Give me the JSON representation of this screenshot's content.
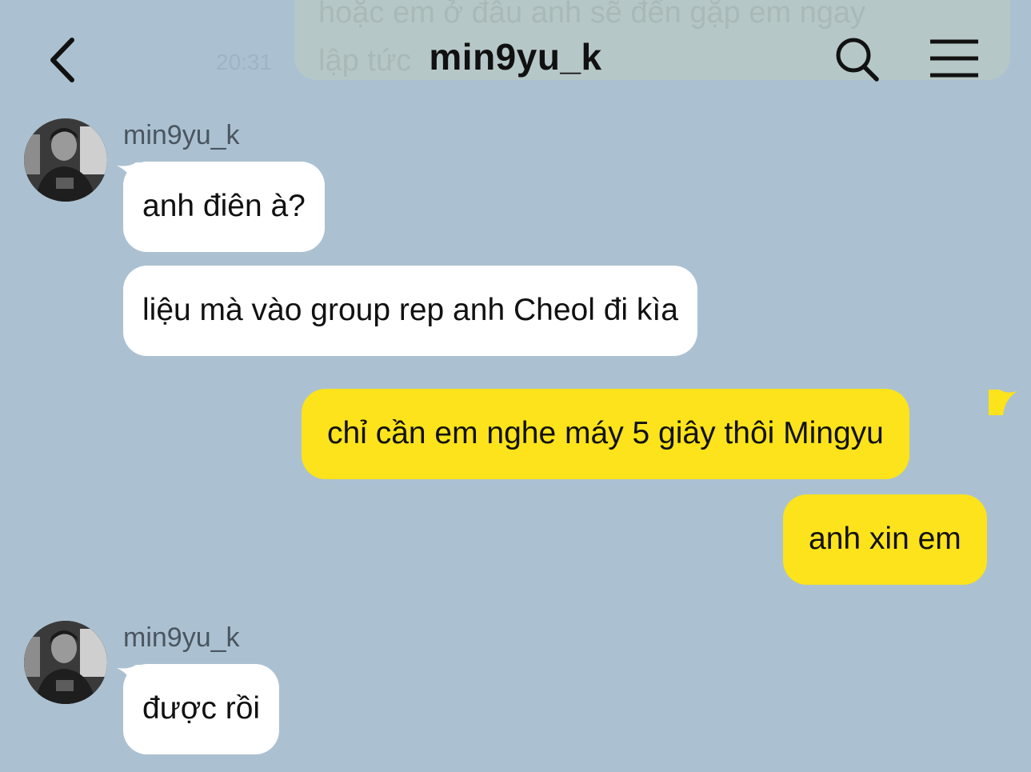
{
  "header": {
    "title": "min9yu_k",
    "back_icon": "chevron-left-icon",
    "search_icon": "search-icon",
    "menu_icon": "hamburger-menu-icon"
  },
  "previous_message": {
    "text": "hoặc em ở đâu anh sẽ đến gặp em ngay\nlập tức",
    "time": "20:31"
  },
  "messages": [
    {
      "sender": "min9yu_k",
      "text": "anh điên à?"
    },
    {
      "text": "liệu mà vào group rep anh Cheol đi kìa"
    },
    {
      "text": "chỉ cần em nghe máy 5 giây thôi Mingyu"
    },
    {
      "text": "anh xin em"
    },
    {
      "sender": "min9yu_k",
      "text": "được rồi"
    }
  ],
  "colors": {
    "background": "#abc1d1",
    "incoming_bubble": "#ffffff",
    "outgoing_bubble": "#fce31b",
    "text": "#111111",
    "sender_name": "#4a5560"
  }
}
